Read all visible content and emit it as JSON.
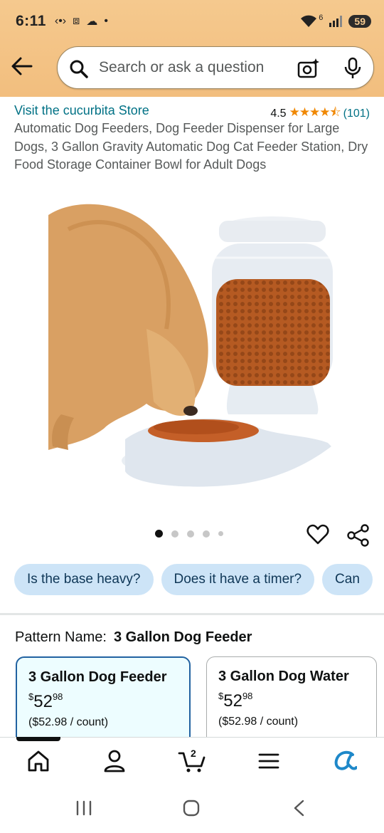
{
  "status_bar": {
    "time": "6:11",
    "battery": "59",
    "signal": "6"
  },
  "search": {
    "placeholder": "Search or ask a question"
  },
  "product": {
    "store_link": "Visit the cucurbita Store",
    "rating": "4.5",
    "stars": "★★★★⯪",
    "review_count": "(101)",
    "title": "Automatic Dog Feeders, Dog Feeder Dispenser for Large Dogs, 3 Gallon Gravity Automatic Dog Cat Feeder Station, Dry Food Storage Container Bowl for Adult Dogs",
    "image_count": 5,
    "image_index": 1
  },
  "questions": [
    "Is the base heavy?",
    "Does it have a timer?",
    "Can"
  ],
  "pattern": {
    "label": "Pattern Name:",
    "selected": "3 Gallon Dog Feeder"
  },
  "options": [
    {
      "name": "3 Gallon Dog Feeder",
      "currency": "$",
      "price_whole": "52",
      "price_fraction": "98",
      "unit_price": "($52.98 / count)"
    },
    {
      "name": "3 Gallon Dog Water",
      "currency": "$",
      "price_whole": "52",
      "price_fraction": "98",
      "unit_price": "($52.98 / count)"
    }
  ],
  "bottom_nav": {
    "cart_count": "2",
    "items": [
      "home-icon",
      "account-icon",
      "cart-icon",
      "menu-icon",
      "rufus-icon"
    ]
  },
  "colors": {
    "header": "#f2be7e",
    "link": "#007185",
    "star": "#f08804",
    "chip": "#cde4f7",
    "selected_border": "#2162a1"
  }
}
